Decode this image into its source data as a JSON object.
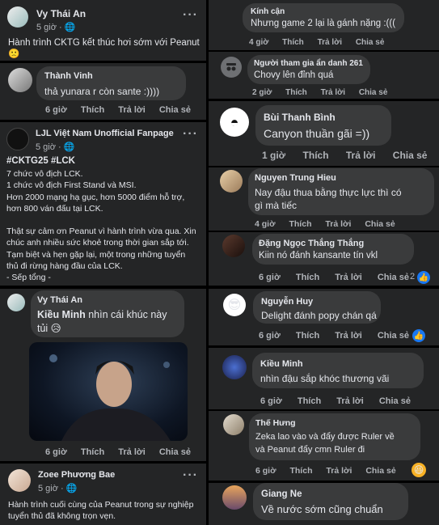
{
  "left": {
    "post1": {
      "author": "Vy Thái An",
      "time": "5 giờ · ",
      "text": "Hành trình CKTG kết thúc hơi sớm với Peanut 🙁"
    },
    "comment1": {
      "author": "Thành Vinh",
      "text": "thả yunara r còn sante :))))",
      "time": "6 giờ",
      "like": "Thích",
      "reply": "Trả lời",
      "share": "Chia sẻ"
    },
    "post2": {
      "page": "LJL Việt Nam Unofficial Fanpage",
      "time": "5 giờ · ",
      "hashtags": "#CKTG25 #LCK",
      "lines": [
        "7 chức vô địch LCK.",
        "1 chức vô địch First Stand và MSI.",
        "Hơn 2000 mạng hạ gục, hơn 5000 điểm hỗ trợ,",
        "hơn 800 ván đấu tại LCK.",
        "",
        "Thật sự cảm ơn Peanut vì hành trình vừa qua. Xin",
        "chúc anh nhiều sức khoẻ trong thời gian sắp tới.",
        "Tạm biệt và hẹn gặp lại, một trong những tuyển",
        "thủ đi rừng hàng đầu của LCK.",
        "- Sếp tổng -"
      ]
    },
    "comment2": {
      "author": "Vy Thái An",
      "mention": "Kiều Minh",
      "text1": " nhìn cái khúc này",
      "text2": "tủi 😥",
      "time": "6 giờ",
      "like": "Thích",
      "reply": "Trả lời",
      "share": "Chia sẻ"
    },
    "post3": {
      "author": "Zoee Phương Bae",
      "time": "5 giờ · ",
      "lines": [
        "Hành trình cuối cùng của Peanut trong sự nghiệp",
        "tuyển thủ đã không trọn vẹn."
      ]
    }
  },
  "right": {
    "c1": {
      "author": "Kính cận",
      "text": "Nhưng game 2 lại là gánh nặng :(((",
      "time": "4 giờ",
      "like": "Thích",
      "reply": "Trả lời",
      "share": "Chia sẻ"
    },
    "c2": {
      "author": "Người tham gia ẩn danh 261",
      "text": "Chovy lên đỉnh quá",
      "time": "2 giờ",
      "like": "Thích",
      "reply": "Trả lời",
      "share": "Chia sẻ"
    },
    "c3": {
      "author": "Bùi Thanh Bình",
      "text": "Canyon thuần gãi =))",
      "time": "1 giờ",
      "like": "Thích",
      "reply": "Trả lời",
      "share": "Chia sẻ"
    },
    "c4": {
      "author": "Nguyen Trung Hieu",
      "text1": "Nay đậu thua bằng thực lực thì có",
      "text2": "gì mà tiếc",
      "time": "4 giờ",
      "like": "Thích",
      "reply": "Trả lời",
      "share": "Chia sẻ"
    },
    "c5": {
      "author": "Đặng Ngọc Thắng Thắng",
      "text": "Kiin nó đánh kansante tín vkl",
      "time": "6 giờ",
      "like": "Thích",
      "reply": "Trả lời",
      "share": "Chia sẻ",
      "reactions": "2"
    },
    "c6": {
      "author": "Nguyễn Huy",
      "text": "Delight đánh popy chán qá",
      "time": "6 giờ",
      "like": "Thích",
      "reply": "Trả lời",
      "share": "Chia sẻ"
    },
    "c7": {
      "author": "Kiều Minh",
      "text": "nhìn đậu sắp khóc thương vãi",
      "time": "6 giờ",
      "like": "Thích",
      "reply": "Trả lời",
      "share": "Chia sẻ"
    },
    "c8": {
      "author": "Thế Hưng",
      "text1": "Zeka lao vào và đẩy được Ruler về",
      "text2": "và Peanut đẩy cmn Ruler đi",
      "time": "6 giờ",
      "like": "Thích",
      "reply": "Trả lời",
      "share": "Chia sẻ"
    },
    "c9": {
      "author": "Giang Ne",
      "text": "Về nước sớm cũng chuẩn"
    }
  },
  "colors": {
    "card": "#242526",
    "bubble": "#3a3b3c",
    "text": "#e4e6eb",
    "muted": "#b0b3b8",
    "like_blue": "#1877f2",
    "haha": "#f7b125"
  },
  "icons": [
    "more-dots-icon",
    "globe-icon",
    "like-reaction-icon",
    "haha-reaction-icon"
  ]
}
